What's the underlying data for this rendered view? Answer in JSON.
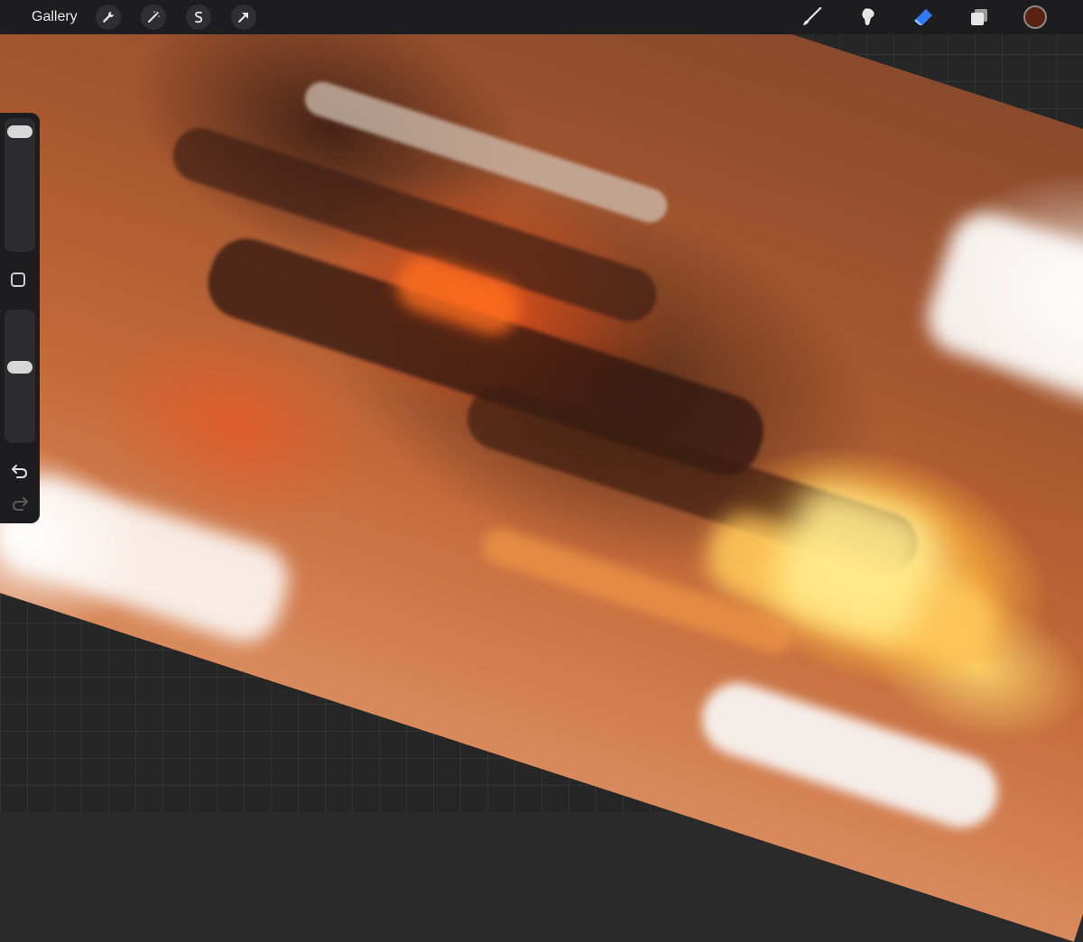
{
  "toolbar": {
    "gallery_label": "Gallery",
    "left_tools": [
      "wrench-icon",
      "magic-wand-icon",
      "selection-icon",
      "transform-arrow-icon"
    ],
    "right_tools": [
      "brush-icon",
      "smudge-icon",
      "eraser-icon",
      "layers-icon"
    ],
    "active_tool": "eraser-icon",
    "accent_color": "#2f7bf5",
    "current_color": "#5a2210"
  },
  "sidebar": {
    "brush_size_level": 0.97,
    "opacity_level": 0.58
  }
}
